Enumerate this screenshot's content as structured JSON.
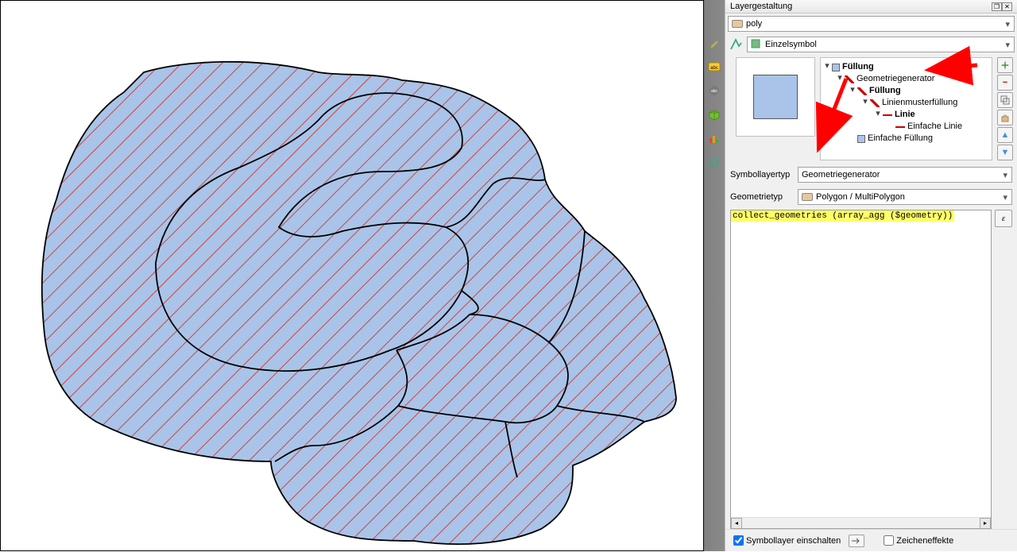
{
  "panel": {
    "title": "Layergestaltung",
    "layer_name": "poly",
    "renderer": "Einzelsymbol",
    "tree": {
      "root": "Füllung",
      "geomgen": "Geometriegenerator",
      "fill": "Füllung",
      "linepattern": "Linienmusterfüllung",
      "line": "Linie",
      "simpleline": "Einfache Linie",
      "simplefill": "Einfache Füllung"
    },
    "symbol_layer_type_label": "Symbollayertyp",
    "symbol_layer_type_value": "Geometriegenerator",
    "geometry_type_label": "Geometrietyp",
    "geometry_type_value": "Polygon / MultiPolygon",
    "expression": "collect_geometries (array_agg ($geometry))",
    "epsilon": "ε",
    "footer": {
      "enable_label": "Symbollayer einschalten",
      "effects_label": "Zeicheneffekte"
    }
  },
  "colors": {
    "fill": "#a9c4e8",
    "hatch": "#cc4444",
    "outline": "#000000"
  }
}
